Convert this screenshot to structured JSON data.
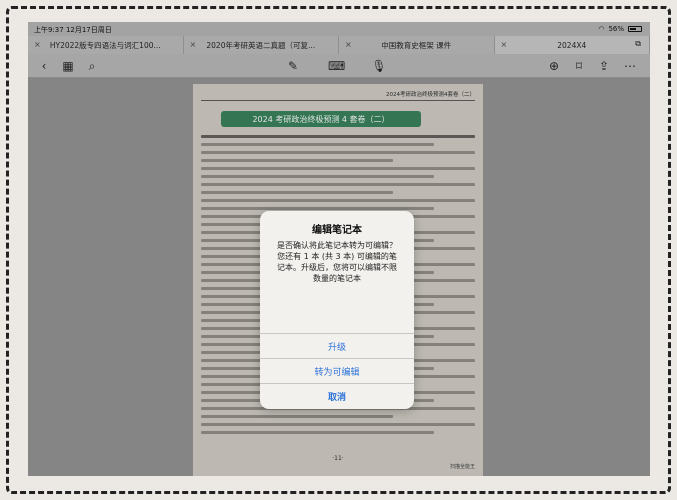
{
  "status_bar": {
    "time_date": "上午9:37  12月17日周日",
    "battery_percent": "56%"
  },
  "tabs": [
    {
      "title": "HY2022版专四语法与词汇100..."
    },
    {
      "title": "2020年考研英语二真题（可复..."
    },
    {
      "title": "中国教育史框架 课件"
    },
    {
      "title": "2024X4"
    }
  ],
  "toolbar_icons": [
    "back-icon",
    "grid-icon",
    "search-icon",
    "pen-icon",
    "keyboard-icon",
    "microphone-icon",
    "add-page-icon",
    "bookmark-icon",
    "share-icon",
    "more-icon"
  ],
  "document": {
    "header": "2024考研政治终极预测4套卷（二）",
    "banner": "2024 考研政治终极预测 4 套卷（二）",
    "page_number": "·11·",
    "scanner_logo": "扫描全能王"
  },
  "dialog": {
    "title": "编辑笔记本",
    "message": "是否确认将此笔记本转为可编辑？您还有 1 本 (共 3 本) 可编辑的笔记本。升级后，您将可以编辑不限数量的笔记本",
    "buttons": {
      "upgrade": "升级",
      "convert": "转为可编辑",
      "cancel": "取消"
    }
  },
  "colors": {
    "accent": "#2b72d9",
    "banner": "#2f7d55"
  }
}
